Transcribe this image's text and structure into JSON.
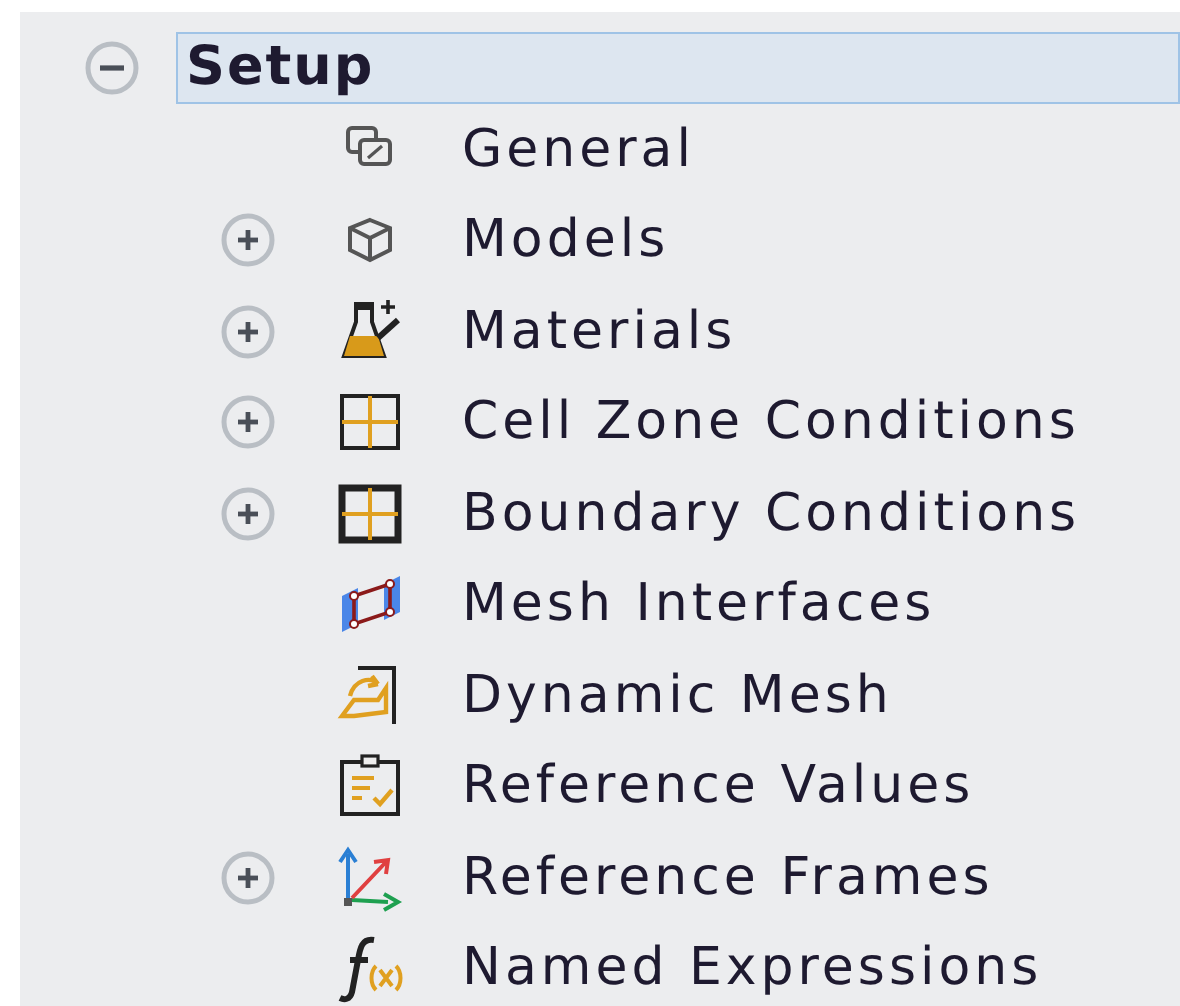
{
  "tree": {
    "label": "Setup",
    "expanded": true,
    "selected": true,
    "children": [
      {
        "label": "General",
        "kind": "general",
        "selected": false
      },
      {
        "label": "Models",
        "kind": "models",
        "expanded": false,
        "selected": false
      },
      {
        "label": "Materials",
        "kind": "materials",
        "expanded": false,
        "selected": false
      },
      {
        "label": "Cell Zone Conditions",
        "kind": "cell-zone",
        "expanded": false,
        "selected": false
      },
      {
        "label": "Boundary Conditions",
        "kind": "boundary",
        "expanded": false,
        "selected": false
      },
      {
        "label": "Mesh Interfaces",
        "kind": "mesh-interfaces",
        "selected": false
      },
      {
        "label": "Dynamic Mesh",
        "kind": "dynamic-mesh",
        "selected": false
      },
      {
        "label": "Reference Values",
        "kind": "reference-values",
        "selected": false
      },
      {
        "label": "Reference Frames",
        "kind": "reference-frames",
        "expanded": false,
        "selected": false
      },
      {
        "label": "Named Expressions",
        "kind": "named-expressions",
        "selected": false
      }
    ]
  }
}
